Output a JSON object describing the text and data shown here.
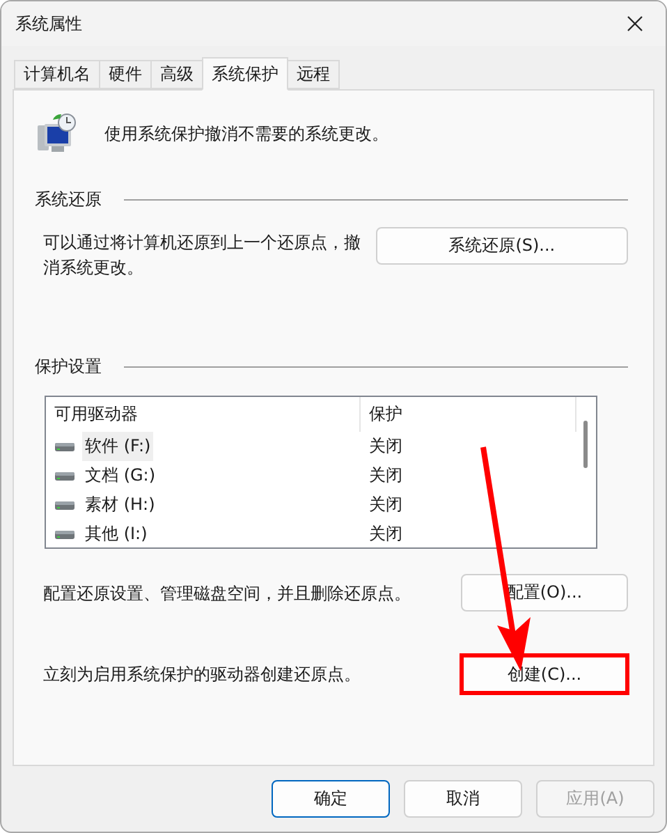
{
  "window": {
    "title": "系统属性"
  },
  "tabs": [
    {
      "label": "计算机名",
      "selected": false
    },
    {
      "label": "硬件",
      "selected": false
    },
    {
      "label": "高级",
      "selected": false
    },
    {
      "label": "系统保护",
      "selected": true
    },
    {
      "label": "远程",
      "selected": false
    }
  ],
  "intro": "使用系统保护撤消不需要的系统更改。",
  "restore_section": {
    "title": "系统还原",
    "text": "可以通过将计算机还原到上一个还原点，撤消系统更改。",
    "button": "系统还原(S)..."
  },
  "protection_section": {
    "title": "保护设置",
    "columns": [
      "可用驱动器",
      "保护"
    ],
    "rows": [
      {
        "drive": "软件 (F:)",
        "protection": "关闭",
        "selected": true
      },
      {
        "drive": "文档 (G:)",
        "protection": "关闭",
        "selected": false
      },
      {
        "drive": "素材 (H:)",
        "protection": "关闭",
        "selected": false
      },
      {
        "drive": "其他 (I:)",
        "protection": "关闭",
        "selected": false
      }
    ],
    "configure_text": "配置还原设置、管理磁盘空间，并且删除还原点。",
    "configure_button": "配置(O)...",
    "create_text": "立刻为启用系统保护的驱动器创建还原点。",
    "create_button": {
      "label": "创建(C)...",
      "highlighted": true
    }
  },
  "buttons": [
    {
      "label": "确定",
      "kind": "default",
      "disabled": false
    },
    {
      "label": "取消",
      "kind": "normal",
      "disabled": false
    },
    {
      "label": "应用(A)",
      "kind": "normal",
      "disabled": true
    }
  ]
}
